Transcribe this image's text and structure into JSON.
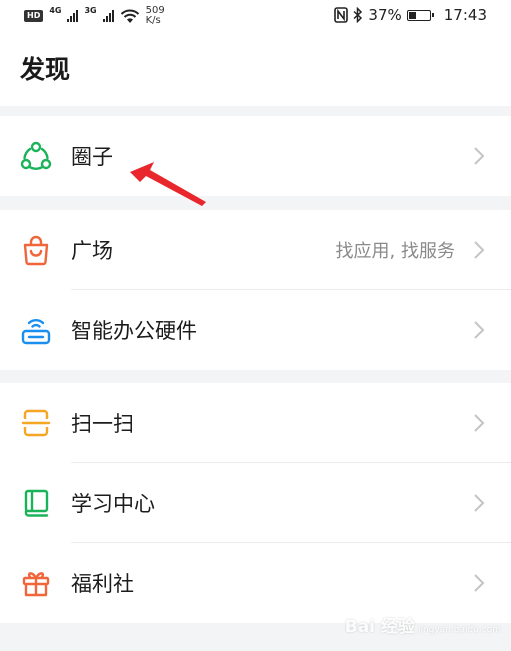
{
  "status_bar": {
    "hd": "HD",
    "net1": "4G",
    "net2": "3G",
    "speed_value": "509",
    "speed_unit": "K/s",
    "battery": "37%",
    "battery_level": 0.37,
    "time": "17:43"
  },
  "page": {
    "title": "发现"
  },
  "groups": [
    {
      "items": [
        {
          "label": "圈子",
          "icon": "circle-group-icon",
          "color": "#1bb35a"
        }
      ]
    },
    {
      "items": [
        {
          "label": "广场",
          "hint": "找应用, 找服务",
          "icon": "shopping-bag-icon",
          "color": "#f0663a"
        },
        {
          "label": "智能办公硬件",
          "icon": "smart-device-icon",
          "color": "#1a8ff0"
        }
      ]
    },
    {
      "items": [
        {
          "label": "扫一扫",
          "icon": "scan-icon",
          "color": "#f5a623"
        },
        {
          "label": "学习中心",
          "icon": "book-icon",
          "color": "#1bb35a"
        },
        {
          "label": "福利社",
          "icon": "gift-icon",
          "color": "#f0663a"
        }
      ]
    }
  ],
  "annotation": {
    "arrow_color": "#e8262c"
  },
  "watermark": {
    "text": "Bai 经验",
    "sub": "jingyan.baidu.com"
  }
}
